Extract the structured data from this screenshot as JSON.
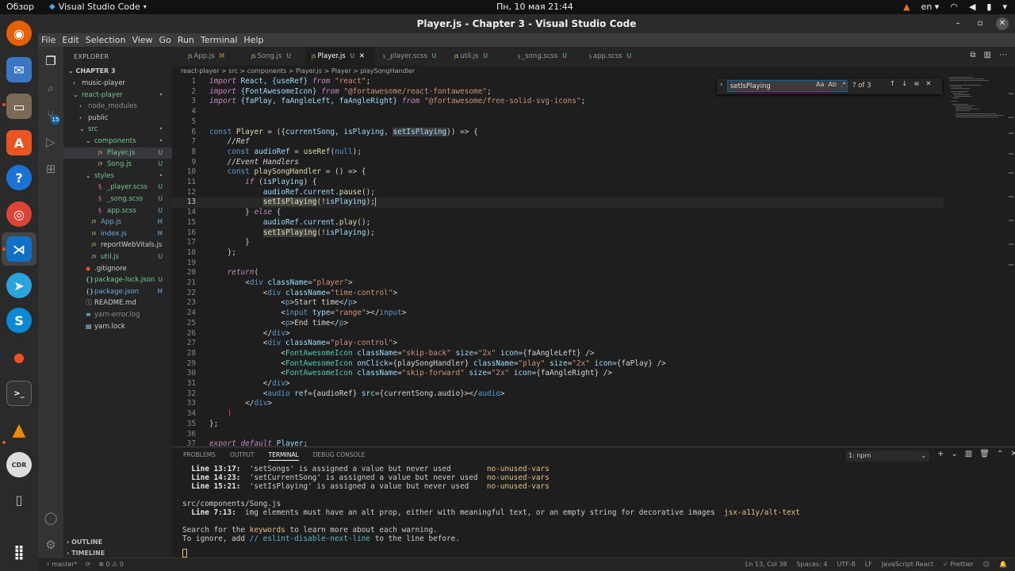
{
  "topbar": {
    "overview": "Обзор",
    "app_name": "Visual Studio Code",
    "clock": "Пн, 10 мая  21:44",
    "language": "en"
  },
  "window": {
    "title": "Player.js - Chapter 3 - Visual Studio Code"
  },
  "menu": [
    "File",
    "Edit",
    "Selection",
    "View",
    "Go",
    "Run",
    "Terminal",
    "Help"
  ],
  "activity": {
    "scm_badge": "15"
  },
  "explorer": {
    "header": "EXPLORER",
    "project": "CHAPTER 3",
    "tree": [
      {
        "label": "music-player",
        "status": "",
        "color": "#cccccc"
      },
      {
        "label": "react-player",
        "status": "•",
        "color": "#73c991"
      },
      {
        "label": "node_modules",
        "status": "",
        "color": "#8c8c8c"
      },
      {
        "label": "public",
        "status": "",
        "color": "#cccccc"
      },
      {
        "label": "src",
        "status": "•",
        "color": "#73c991"
      },
      {
        "label": "components",
        "status": "•",
        "color": "#73c991"
      },
      {
        "label": "Player.js",
        "status": "U",
        "color": "#73c991"
      },
      {
        "label": "Song.js",
        "status": "U",
        "color": "#73c991"
      },
      {
        "label": "styles",
        "status": "•",
        "color": "#73c991"
      },
      {
        "label": "_player.scss",
        "status": "U",
        "color": "#73c991"
      },
      {
        "label": "_song.scss",
        "status": "U",
        "color": "#73c991"
      },
      {
        "label": "app.scss",
        "status": "U",
        "color": "#73c991"
      },
      {
        "label": "App.js",
        "status": "M",
        "color": "#6fa8dc"
      },
      {
        "label": "index.js",
        "status": "M",
        "color": "#6fa8dc"
      },
      {
        "label": "reportWebVitals.js",
        "status": "",
        "color": "#cccccc"
      },
      {
        "label": "util.js",
        "status": "U",
        "color": "#73c991"
      },
      {
        "label": ".gitignore",
        "status": "",
        "color": "#cccccc"
      },
      {
        "label": "package-lock.json",
        "status": "U",
        "color": "#73c991"
      },
      {
        "label": "package.json",
        "status": "M",
        "color": "#6fa8dc"
      },
      {
        "label": "README.md",
        "status": "",
        "color": "#cccccc"
      },
      {
        "label": "yarn-error.log",
        "status": "",
        "color": "#8c8c8c"
      },
      {
        "label": "yarn.lock",
        "status": "",
        "color": "#cccccc"
      }
    ],
    "outline": "OUTLINE",
    "timeline": "TIMELINE"
  },
  "tabs": [
    {
      "name": "App.js",
      "status": "M"
    },
    {
      "name": "Song.js",
      "status": "U"
    },
    {
      "name": "Player.js",
      "status": "U"
    },
    {
      "name": "_player.scss",
      "status": "U"
    },
    {
      "name": "util.js",
      "status": "U"
    },
    {
      "name": "_song.scss",
      "status": "U"
    },
    {
      "name": "app.scss",
      "status": "U"
    }
  ],
  "breadcrumb": "react-player  >  src  >  components  >  Player.js  >  Player  >  playSongHandler",
  "find": {
    "query": "setIsPlaying",
    "count": "? of 3",
    "opt_case": "Aa",
    "opt_word": "Ab",
    "opt_regex": ".*"
  },
  "code_lines": [
    "1",
    "2",
    "3",
    "4",
    "5",
    "6",
    "7",
    "8",
    "9",
    "10",
    "11",
    "12",
    "13",
    "14",
    "15",
    "16",
    "17",
    "18",
    "19",
    "20",
    "21",
    "22",
    "23",
    "24",
    "25",
    "26",
    "27",
    "28",
    "29",
    "30",
    "31",
    "32",
    "33",
    "34",
    "35",
    "36",
    "37"
  ],
  "code": {
    "l1_a": "import",
    "l1_b": " React, {useRef} ",
    "l1_c": "from",
    "l1_d": "\"react\"",
    "l1_e": ";",
    "l2_a": "import",
    "l2_b": " {FontAwesomeIcon} ",
    "l2_c": "from",
    "l2_d": "\"@fortawesome/react-fontawesome\"",
    "l2_e": ";",
    "l3_a": "import",
    "l3_b": " {faPlay, faAngleLeft, faAngleRight} ",
    "l3_c": "from",
    "l3_d": "\"@fortawesome/free-solid-svg-icons\"",
    "l3_e": ";",
    "l6_a": "const",
    "l6_b": " Player",
    "l6_c": " = ({",
    "l6_d": "currentSong",
    "l6_e": ", ",
    "l6_f": "isPlaying",
    "l6_g": ", ",
    "l6_h": "setIsPlaying",
    "l6_i": "}) => {",
    "l7": "    //Ref",
    "l8_a": "    const",
    "l8_b": " audioRef",
    "l8_c": " = ",
    "l8_d": "useRef",
    "l8_e": "(",
    "l8_f": "null",
    "l8_g": ");",
    "l9": "    //Event Handlers",
    "l10_a": "    const",
    "l10_b": " playSongHandler",
    "l10_c": " = () => {",
    "l11_a": "        if",
    "l11_b": " (",
    "l11_c": "isPlaying",
    "l11_d": ") {",
    "l12_a": "            audioRef",
    "l12_b": ".",
    "l12_c": "current",
    "l12_d": ".",
    "l12_e": "pause",
    "l12_f": "();",
    "l13_a": "            ",
    "l13_b": "setIsPlaying",
    "l13_c": "(!",
    "l13_d": "isPlaying",
    "l13_e": ");",
    "l14_a": "        } ",
    "l14_b": "else",
    "l14_c": " {",
    "l15_a": "            audioRef",
    "l15_b": ".",
    "l15_c": "current",
    "l15_d": ".",
    "l15_e": "play",
    "l15_f": "();",
    "l16_a": "            ",
    "l16_b": "setIsPlaying",
    "l16_c": "(!",
    "l16_d": "isPlaying",
    "l16_e": ");",
    "l17": "        }",
    "l18": "    };",
    "l20_a": "    return",
    "l20_b": "(",
    "l21_a": "        <",
    "l21_b": "div",
    "l21_c": " className",
    "l21_d": "=",
    "l21_e": "\"player\"",
    "l21_f": ">",
    "l22_a": "            <",
    "l22_b": "div",
    "l22_c": " className",
    "l22_d": "=",
    "l22_e": "\"time-control\"",
    "l22_f": ">",
    "l23_a": "                <",
    "l23_b": "p",
    "l23_c": ">Start time</",
    "l23_d": "p",
    "l23_e": ">",
    "l24_a": "                <",
    "l24_b": "input",
    "l24_c": " type",
    "l24_d": "=",
    "l24_e": "\"range\"",
    "l24_f": "></",
    "l24_g": "input",
    "l24_h": ">",
    "l25_a": "                <",
    "l25_b": "p",
    "l25_c": ">End time</",
    "l25_d": "p",
    "l25_e": ">",
    "l26_a": "            </",
    "l26_b": "div",
    "l26_c": ">",
    "l27_a": "            <",
    "l27_b": "div",
    "l27_c": " className",
    "l27_d": "=",
    "l27_e": "\"play-control\"",
    "l27_f": ">",
    "l28_a": "                <",
    "l28_b": "FontAwesomeIcon",
    "l28_c": " className",
    "l28_d": "=",
    "l28_e": "\"skip-back\"",
    "l28_f": " size",
    "l28_g": "=",
    "l28_h": "\"2x\"",
    "l28_i": " icon",
    "l28_j": "={faAngleLeft} />",
    "l29_a": "                <",
    "l29_b": "FontAwesomeIcon",
    "l29_c": " onClick",
    "l29_d": "={playSongHandler}",
    "l29_e": " className",
    "l29_f": "=",
    "l29_g": "\"play\"",
    "l29_h": " size",
    "l29_i": "=",
    "l29_j": "\"2x\"",
    "l29_k": " icon",
    "l29_l": "={faPlay} />",
    "l30_a": "                <",
    "l30_b": "FontAwesomeIcon",
    "l30_c": " className",
    "l30_d": "=",
    "l30_e": "\"skip-forward\"",
    "l30_f": " size",
    "l30_g": "=",
    "l30_h": "\"2x\"",
    "l30_i": " icon",
    "l30_j": "={faAngleRight} />",
    "l31_a": "            </",
    "l31_b": "div",
    "l31_c": ">",
    "l32_a": "            <",
    "l32_b": "audio",
    "l32_c": " ref",
    "l32_d": "={audioRef}",
    "l32_e": " src",
    "l32_f": "={currentSong.audio}></",
    "l32_g": "audio",
    "l32_h": ">",
    "l33_a": "        </",
    "l33_b": "div",
    "l33_c": ">",
    "l34": "    )",
    "l35": "};",
    "l37_a": "export",
    "l37_b": " default",
    "l37_c": " Player",
    "l37_d": ";"
  },
  "panel": {
    "tabs": [
      "PROBLEMS",
      "OUTPUT",
      "TERMINAL",
      "DEBUG CONSOLE"
    ],
    "terminal_select": "1: npm",
    "lines": {
      "w1_loc": "  Line 13:17:",
      "w1_msg": "  'setSongs' is assigned a value but never used        ",
      "w1_rule": "no-unused-vars",
      "w2_loc": "  Line 14:23:",
      "w2_msg": "  'setCurrentSong' is assigned a value but never used  ",
      "w2_rule": "no-unused-vars",
      "w3_loc": "  Line 15:21:",
      "w3_msg": "  'setIsPlaying' is assigned a value but never used    ",
      "w3_rule": "no-unused-vars",
      "file": "src/components/Song.js",
      "w4_loc": "  Line 7:13:",
      "w4_msg": "  img elements must have an alt prop, either with meaningful text, or an empty string for decorative images  ",
      "w4_rule": "jsx-a11y/alt-text",
      "s1_a": "Search for the ",
      "s1_b": "keywords",
      "s1_c": " to learn more about each warning.",
      "s2_a": "To ignore, add ",
      "s2_b": "// eslint-disable-next-line",
      "s2_c": " to the line before."
    }
  },
  "status": {
    "branch": "master*",
    "sync": "",
    "problems": "⊗ 0 ⚠ 0",
    "position": "Ln 13, Col 38",
    "spaces": "Spaces: 4",
    "encoding": "UTF-8",
    "eol": "LF",
    "language": "JavaScript React",
    "prettier": "✓ Prettier"
  },
  "colors": {
    "accent": "#0e639c",
    "untracked": "#73c991",
    "modified": "#c5a332"
  }
}
